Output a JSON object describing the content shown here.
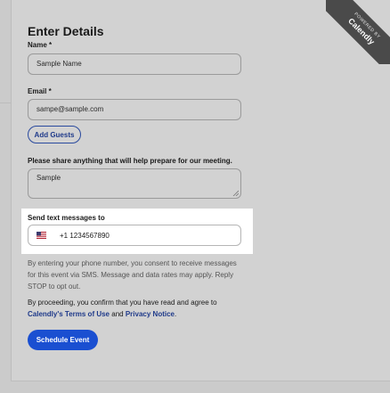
{
  "badge": {
    "powered_by": "POWERED BY",
    "brand": "Calendly"
  },
  "form": {
    "title": "Enter Details",
    "name": {
      "label": "Name *",
      "value": "Sample Name"
    },
    "email": {
      "label": "Email *",
      "value": "sampe@sample.com"
    },
    "add_guests_label": "Add Guests",
    "notes": {
      "label": "Please share anything that will help prepare for our meeting.",
      "value": "Sample"
    },
    "sms": {
      "label": "Send text messages to",
      "country_flag_icon": "us-flag-icon",
      "phone_value": "+1 1234567890"
    },
    "consent_text": "By entering your phone number, you consent to receive messages for this event via SMS. Message and data rates may apply. Reply STOP to opt out.",
    "agree": {
      "prefix": "By proceeding, you confirm that you have read and agree to",
      "terms_link": "Calendly's Terms of Use",
      "and": "and",
      "privacy_link": "Privacy Notice",
      "suffix": "."
    },
    "submit_label": "Schedule Event"
  },
  "colors": {
    "accent": "#1a4fd1",
    "link": "#1f3a8a",
    "highlight": "#ffffff"
  }
}
